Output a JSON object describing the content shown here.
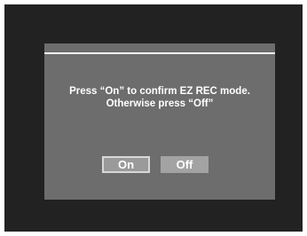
{
  "dialog": {
    "message_line1": "Press “On” to confirm EZ REC mode.",
    "message_line2": "Otherwise press “Off”",
    "on_label": "On",
    "off_label": "Off",
    "selected": "On"
  },
  "colors": {
    "screen_background": "#222222",
    "dialog_background": "#6d6d6d",
    "button_selected": "#9a9a9a",
    "button_default": "#a3a3a3",
    "text": "#ffffff"
  }
}
